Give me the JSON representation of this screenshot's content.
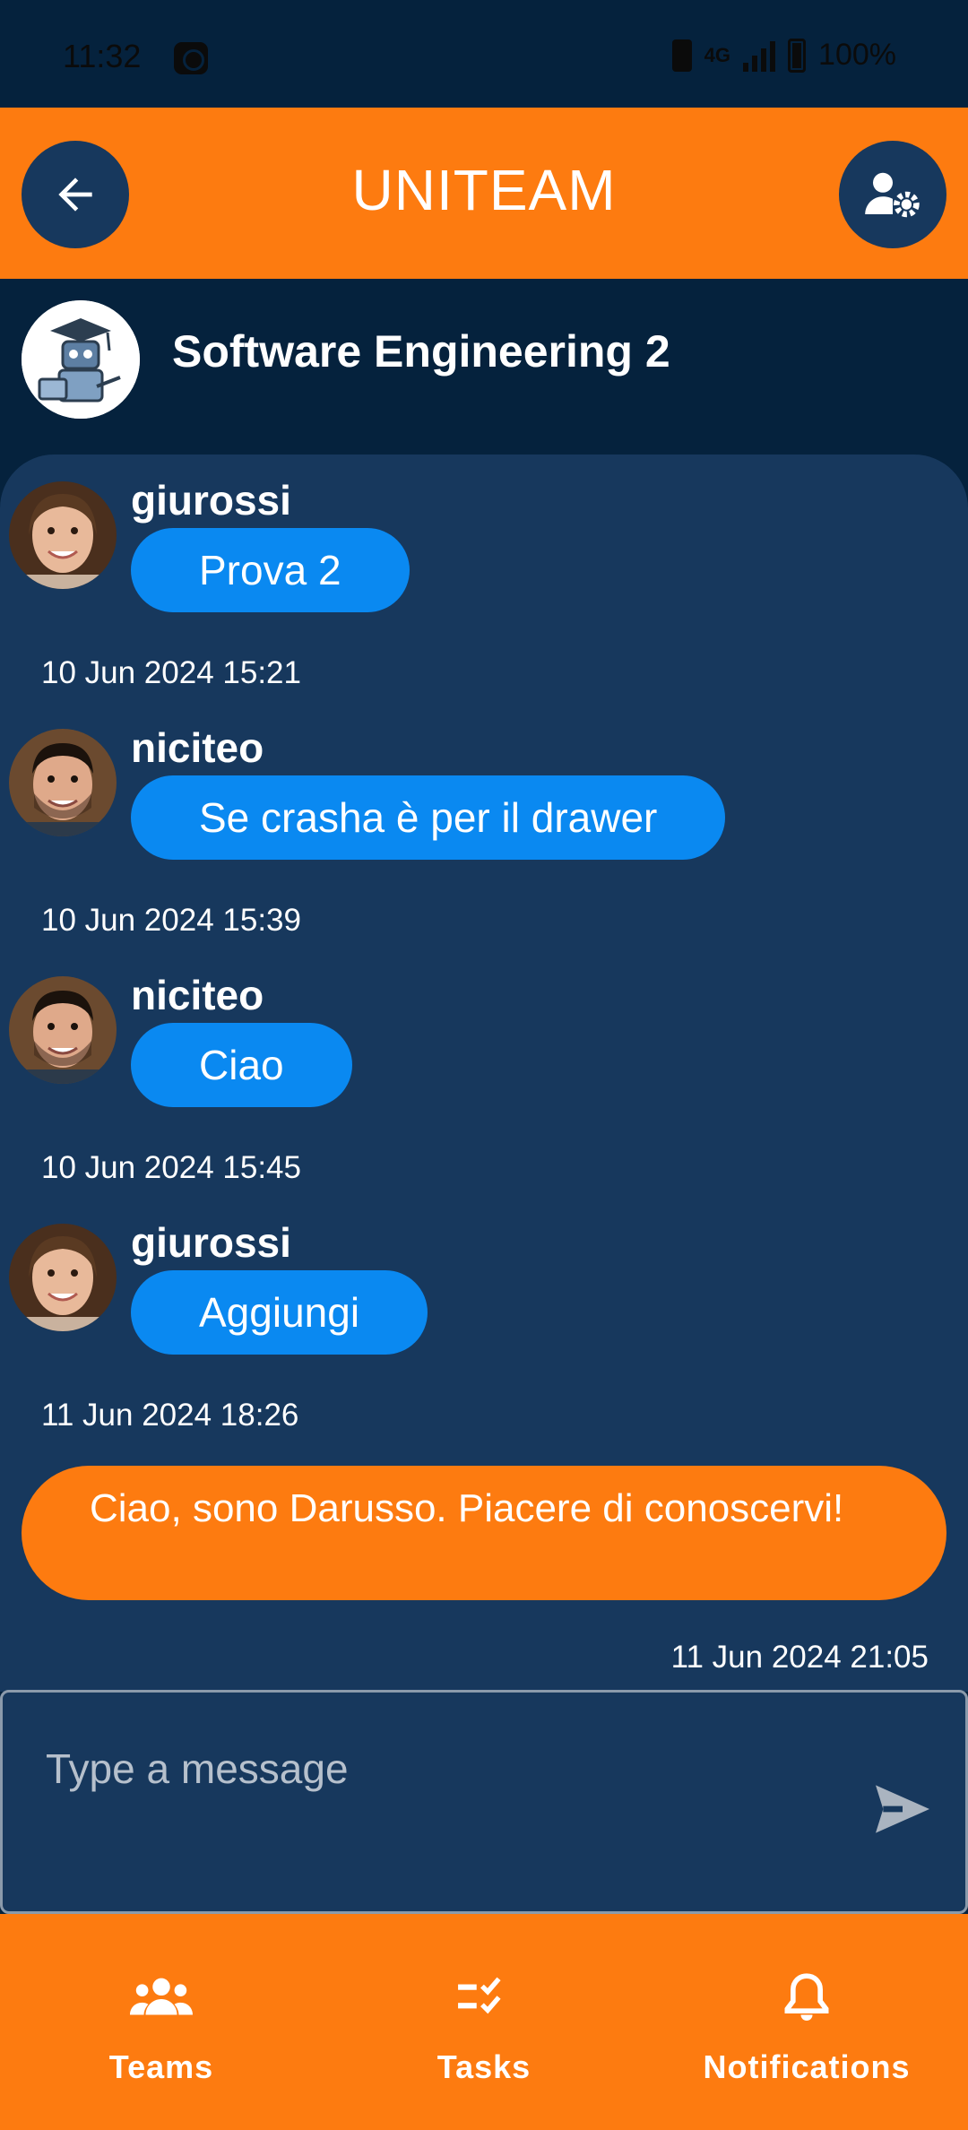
{
  "status_bar": {
    "time": "11:32",
    "network": "4G",
    "battery": "100%"
  },
  "header": {
    "title": "UNITEAM",
    "back_icon": "arrow-left-icon",
    "settings_icon": "user-gear-icon"
  },
  "team": {
    "name": "Software Engineering 2",
    "avatar_icon": "robot-graduate-icon"
  },
  "messages": [
    {
      "sender": "giurossi",
      "text": "Prova 2",
      "timestamp": "10 Jun 2024 15:21"
    },
    {
      "sender": "niciteo",
      "text": "Se crasha è per il drawer",
      "timestamp": "10 Jun 2024 15:39"
    },
    {
      "sender": "niciteo",
      "text": "Ciao",
      "timestamp": "10 Jun 2024 15:45"
    },
    {
      "sender": "giurossi",
      "text": "Aggiungi",
      "timestamp": "11 Jun 2024 18:26"
    }
  ],
  "own_message": {
    "text": "Ciao, sono Darusso. Piacere di conoscervi!",
    "timestamp": "11 Jun 2024 21:05"
  },
  "composer": {
    "placeholder": "Type a message",
    "value": "",
    "send_icon": "send-icon"
  },
  "bottom_nav": {
    "items": [
      {
        "label": "Teams",
        "icon": "group-icon"
      },
      {
        "label": "Tasks",
        "icon": "checklist-icon"
      },
      {
        "label": "Notifications",
        "icon": "bell-icon"
      }
    ]
  },
  "colors": {
    "accent": "#fd7b10",
    "background": "#05223d",
    "panel": "#17385d",
    "bubble": "#0a89f1"
  }
}
